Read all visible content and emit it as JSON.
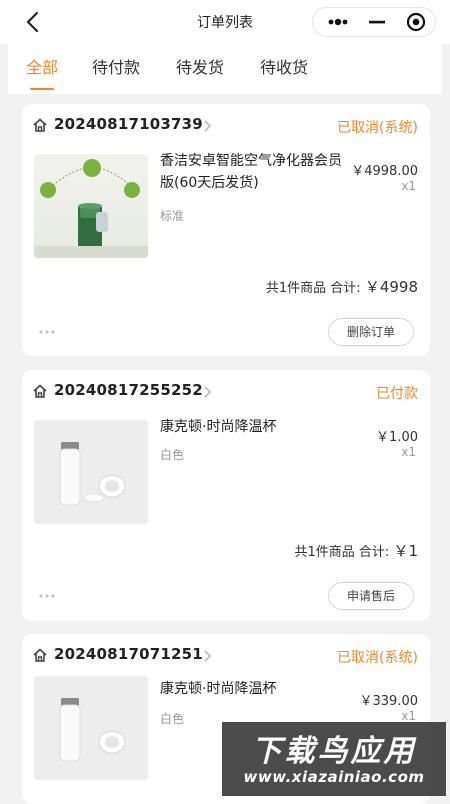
{
  "nav": {
    "title": "订单列表"
  },
  "tabs": [
    {
      "label": "全部",
      "active": true
    },
    {
      "label": "待付款",
      "active": false
    },
    {
      "label": "待发货",
      "active": false
    },
    {
      "label": "待收货",
      "active": false
    }
  ],
  "orders": [
    {
      "order_no": "20240817103739",
      "status": "已取消(系统)",
      "product_name": "香洁安卓智能空气净化器会员版(60天后发货)",
      "spec": "标准",
      "price": "￥4998.00",
      "qty": "x1",
      "summary_count": "共1件商品",
      "summary_label": "合计:",
      "summary_total": "￥4998",
      "action": "删除订单"
    },
    {
      "order_no": "20240817255252",
      "status": "已付款",
      "product_name": "康克顿·时尚降温杯",
      "spec": "白色",
      "price": "￥1.00",
      "qty": "x1",
      "summary_count": "共1件商品",
      "summary_label": "合计:",
      "summary_total": "￥1",
      "action": "申请售后"
    },
    {
      "order_no": "20240817071251",
      "status": "已取消(系统)",
      "product_name": "康克顿·时尚降温杯",
      "spec": "白色",
      "price": "￥339.00",
      "qty": "x1"
    }
  ],
  "watermark": {
    "title": "下载鸟应用",
    "url": "www.xiazainiao.com"
  },
  "colors": {
    "accent": "#e88a2d",
    "background": "#f2f2f2"
  }
}
